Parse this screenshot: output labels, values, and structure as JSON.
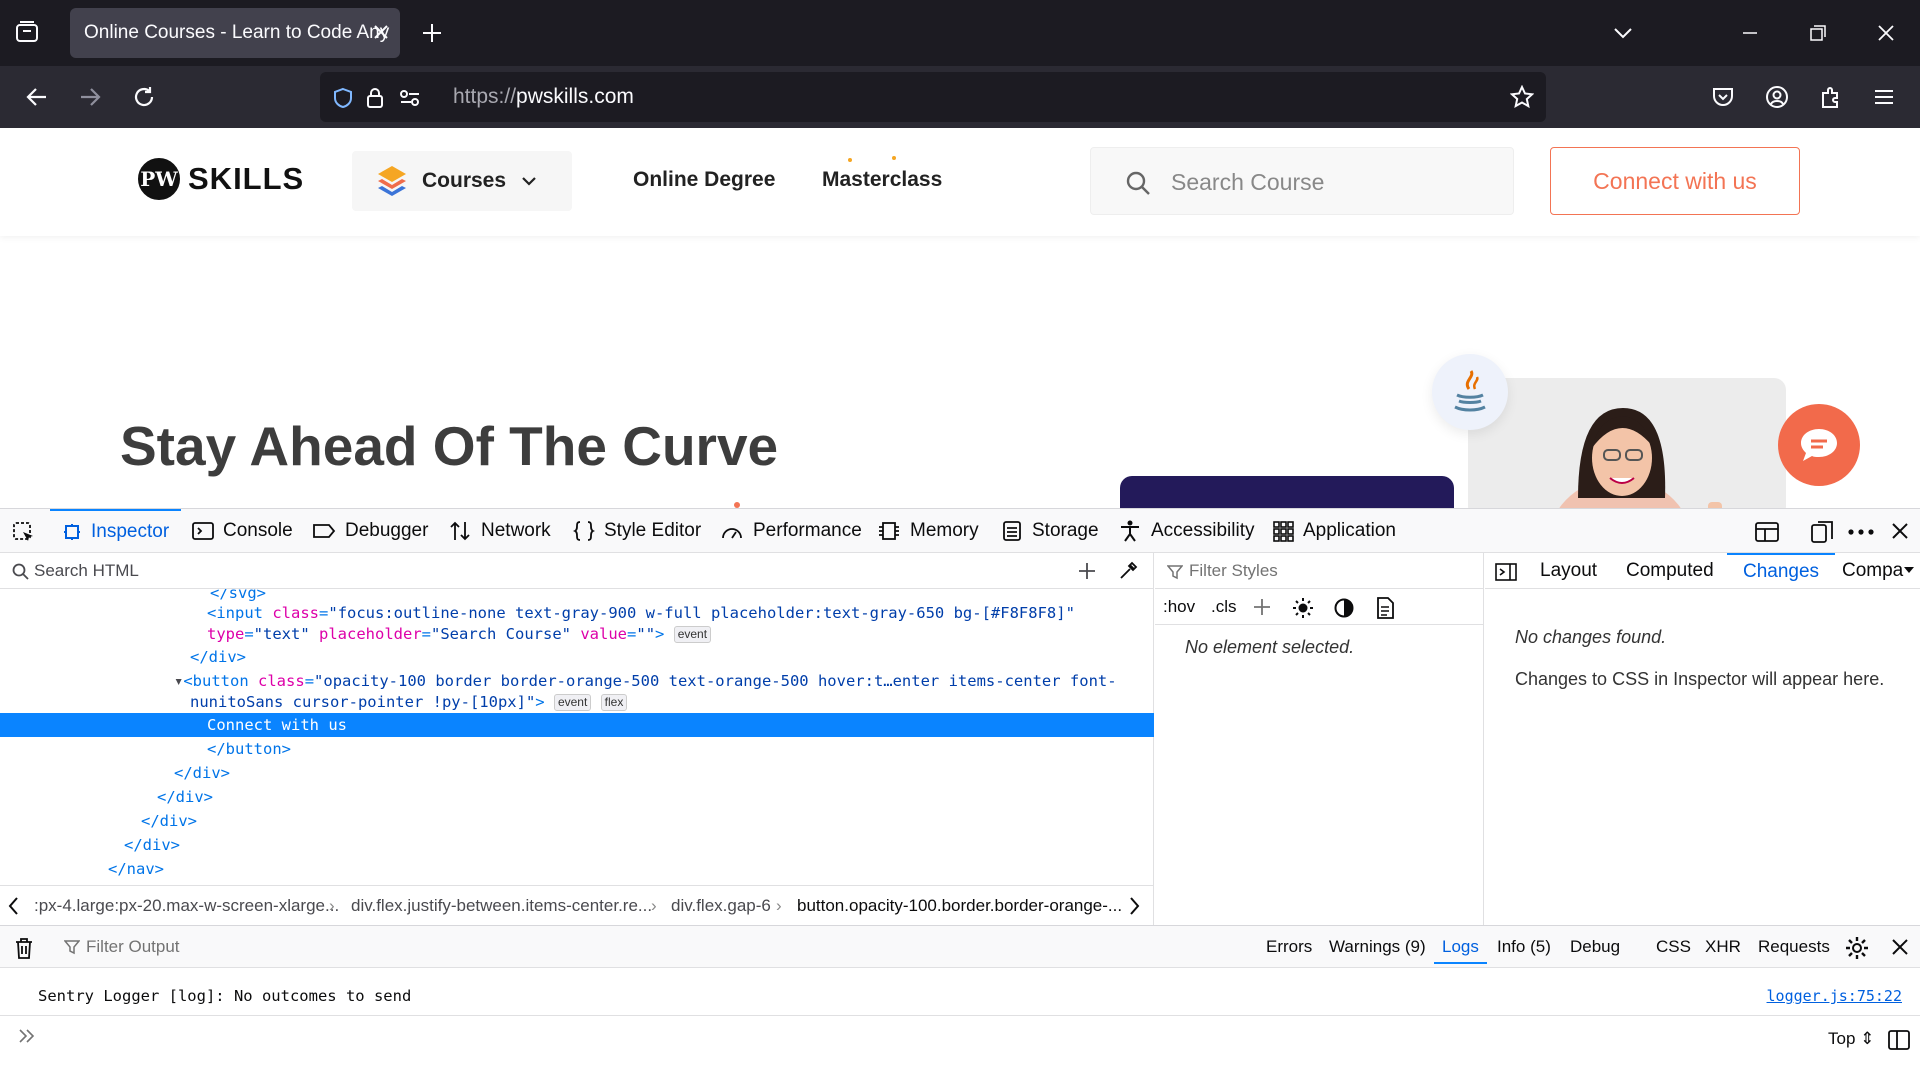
{
  "browser": {
    "tab_title": "Online Courses - Learn to Code Any",
    "url_protocol": "https://",
    "url_host": "pwskills.com"
  },
  "site": {
    "logo_mark": "PW",
    "logo_text": "SKILLS",
    "courses_label": "Courses",
    "nav_links": [
      "Online Degree",
      "Masterclass"
    ],
    "search_placeholder": "Search Course",
    "connect_label": "Connect with us",
    "hero_title": "Stay Ahead Of The Curve",
    "accent_color": "#f37454"
  },
  "devtools": {
    "tabs": [
      "Inspector",
      "Console",
      "Debugger",
      "Network",
      "Style Editor",
      "Performance",
      "Memory",
      "Storage",
      "Accessibility",
      "Application"
    ],
    "search_html_placeholder": "Search HTML",
    "markup": {
      "line0": "</svg>",
      "line1_tag": "<input",
      "line1_attrs": [
        {
          "name": "class",
          "value": "\"focus:outline-none text-gray-900 w-full placeholder:text-gray-650 bg-[#F8F8F8]\""
        },
        {
          "name": "type",
          "value": "\"text\""
        },
        {
          "name": "placeholder",
          "value": "\"Search Course\""
        },
        {
          "name": "value",
          "value": "\"\""
        }
      ],
      "event_badge": "event",
      "flex_badge": "flex",
      "close_div": "</div>",
      "button_open": "<button",
      "button_class_a": "\"opacity-100 border border-orange-500 text-orange-500 hover:t…enter items-center font-",
      "button_class_b": "nunitoSans cursor-pointer !py-[10px]\"",
      "selected_text": "Connect with us",
      "close_button": "</button>",
      "close_nav": "</nav>"
    },
    "breadcrumbs": [
      ":px-4.large:px-20.max-w-screen-xlarge...",
      "div.flex.justify-between.items-center.re...",
      "div.flex.gap-6",
      "button.opacity-100.border.border-orange-..."
    ],
    "filter_styles_placeholder": "Filter Styles",
    "rule_tools": [
      ":hov",
      ".cls"
    ],
    "no_element": "No element selected.",
    "side_tabs": [
      "Layout",
      "Computed",
      "Changes",
      "Compa"
    ],
    "no_changes": "No changes found.",
    "changes_hint": "Changes to CSS in Inspector will appear here."
  },
  "console": {
    "filter_placeholder": "Filter Output",
    "filters": [
      "Errors",
      "Warnings (9)",
      "Logs",
      "Info (5)",
      "Debug",
      "CSS",
      "XHR",
      "Requests"
    ],
    "message": "Sentry Logger [log]: No outcomes to send",
    "message_source": "logger.js:75:22",
    "context": "Top"
  }
}
